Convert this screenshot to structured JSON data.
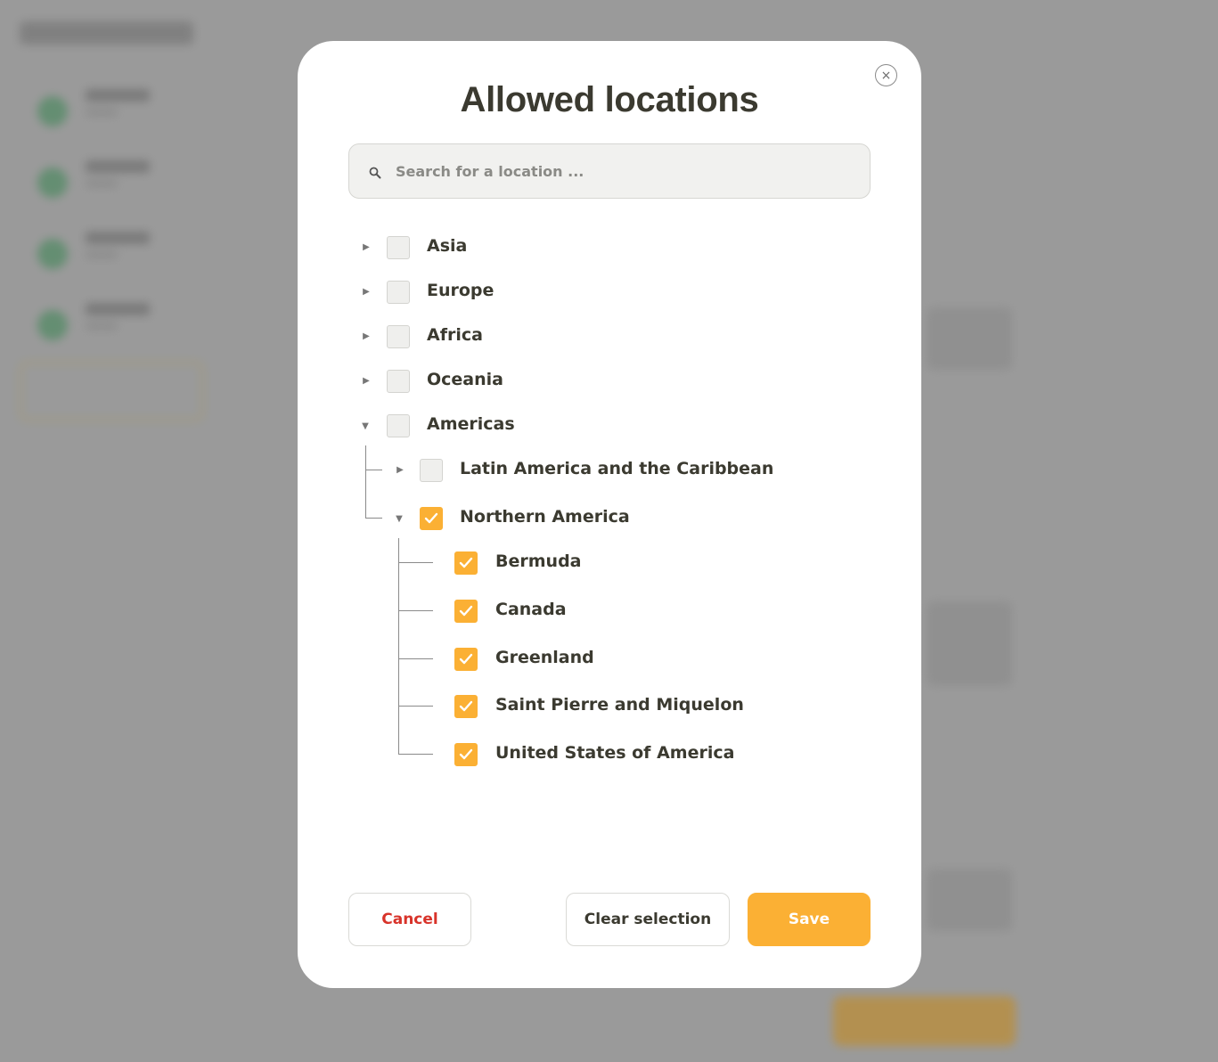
{
  "modal": {
    "title": "Allowed locations",
    "close_glyph": "×",
    "search": {
      "placeholder": "Search for a location ...",
      "value": "",
      "icon": "search-icon"
    }
  },
  "tree": {
    "regions": [
      {
        "label": "Asia",
        "expanded": false,
        "checked": false
      },
      {
        "label": "Europe",
        "expanded": false,
        "checked": false
      },
      {
        "label": "Africa",
        "expanded": false,
        "checked": false
      },
      {
        "label": "Oceania",
        "expanded": false,
        "checked": false
      },
      {
        "label": "Americas",
        "expanded": true,
        "checked": false
      }
    ],
    "subregions": [
      {
        "label": "Latin America and the Caribbean",
        "expanded": false,
        "checked": false
      },
      {
        "label": "Northern America",
        "expanded": true,
        "checked": true
      }
    ],
    "countries": [
      {
        "label": "Bermuda",
        "checked": true
      },
      {
        "label": "Canada",
        "checked": true
      },
      {
        "label": "Greenland",
        "checked": true
      },
      {
        "label": "Saint Pierre and Miquelon",
        "checked": true
      },
      {
        "label": "United States of America",
        "checked": true
      }
    ]
  },
  "footer": {
    "cancel_label": "Cancel",
    "clear_label": "Clear selection",
    "save_label": "Save"
  },
  "colors": {
    "accent": "#fbb034",
    "danger": "#d8332a",
    "text": "#3b3a30",
    "overlay": "#9a9a9a"
  }
}
